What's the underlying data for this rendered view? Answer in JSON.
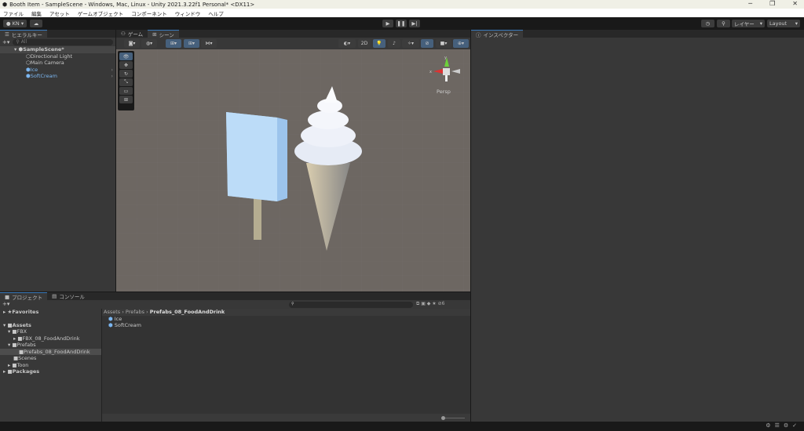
{
  "window": {
    "title": "Booth Item - SampleScene - Windows, Mac, Linux - Unity 2021.3.22f1 Personal* <DX11>",
    "minimize": "─",
    "maximize": "❐",
    "close": "✕"
  },
  "menu": [
    "ファイル",
    "編集",
    "アセット",
    "ゲームオブジェクト",
    "コンポーネント",
    "ウィンドウ",
    "ヘルプ"
  ],
  "toolbar": {
    "account": "KN",
    "layers": "レイヤー",
    "layout": "Layout"
  },
  "hierarchy": {
    "tab": "ヒエラルキー",
    "search_placeholder": "All",
    "scene": "SampleScene*",
    "items": [
      {
        "label": "Directional Light",
        "prefab": false
      },
      {
        "label": "Main Camera",
        "prefab": false
      },
      {
        "label": "Ice",
        "prefab": true
      },
      {
        "label": "SoftCream",
        "prefab": true
      }
    ]
  },
  "scene_view": {
    "tabs": [
      "ゲーム",
      "シーン"
    ],
    "mode_2d": "2D",
    "persp": "Persp",
    "gizmo_x": "x",
    "gizmo_y": "y"
  },
  "inspector": {
    "tab": "インスペクター"
  },
  "project": {
    "tabs": [
      "プロジェクト",
      "コンソール"
    ],
    "tree": [
      {
        "label": "Favorites",
        "depth": 0,
        "bold": true
      },
      {
        "label": "Assets",
        "depth": 0,
        "bold": true
      },
      {
        "label": "FBX",
        "depth": 1
      },
      {
        "label": "FBX_08_FoodAndDrink",
        "depth": 2
      },
      {
        "label": "Prefabs",
        "depth": 1
      },
      {
        "label": "Prefabs_08_FoodAndDrink",
        "depth": 2,
        "selected": true
      },
      {
        "label": "Scenes",
        "depth": 1
      },
      {
        "label": "Toon",
        "depth": 1
      },
      {
        "label": "Packages",
        "depth": 0,
        "bold": true
      }
    ],
    "breadcrumb": [
      "Assets",
      "Prefabs",
      "Prefabs_08_FoodAndDrink"
    ],
    "assets": [
      "Ice",
      "SoftCream"
    ],
    "hidden_count": "6"
  }
}
